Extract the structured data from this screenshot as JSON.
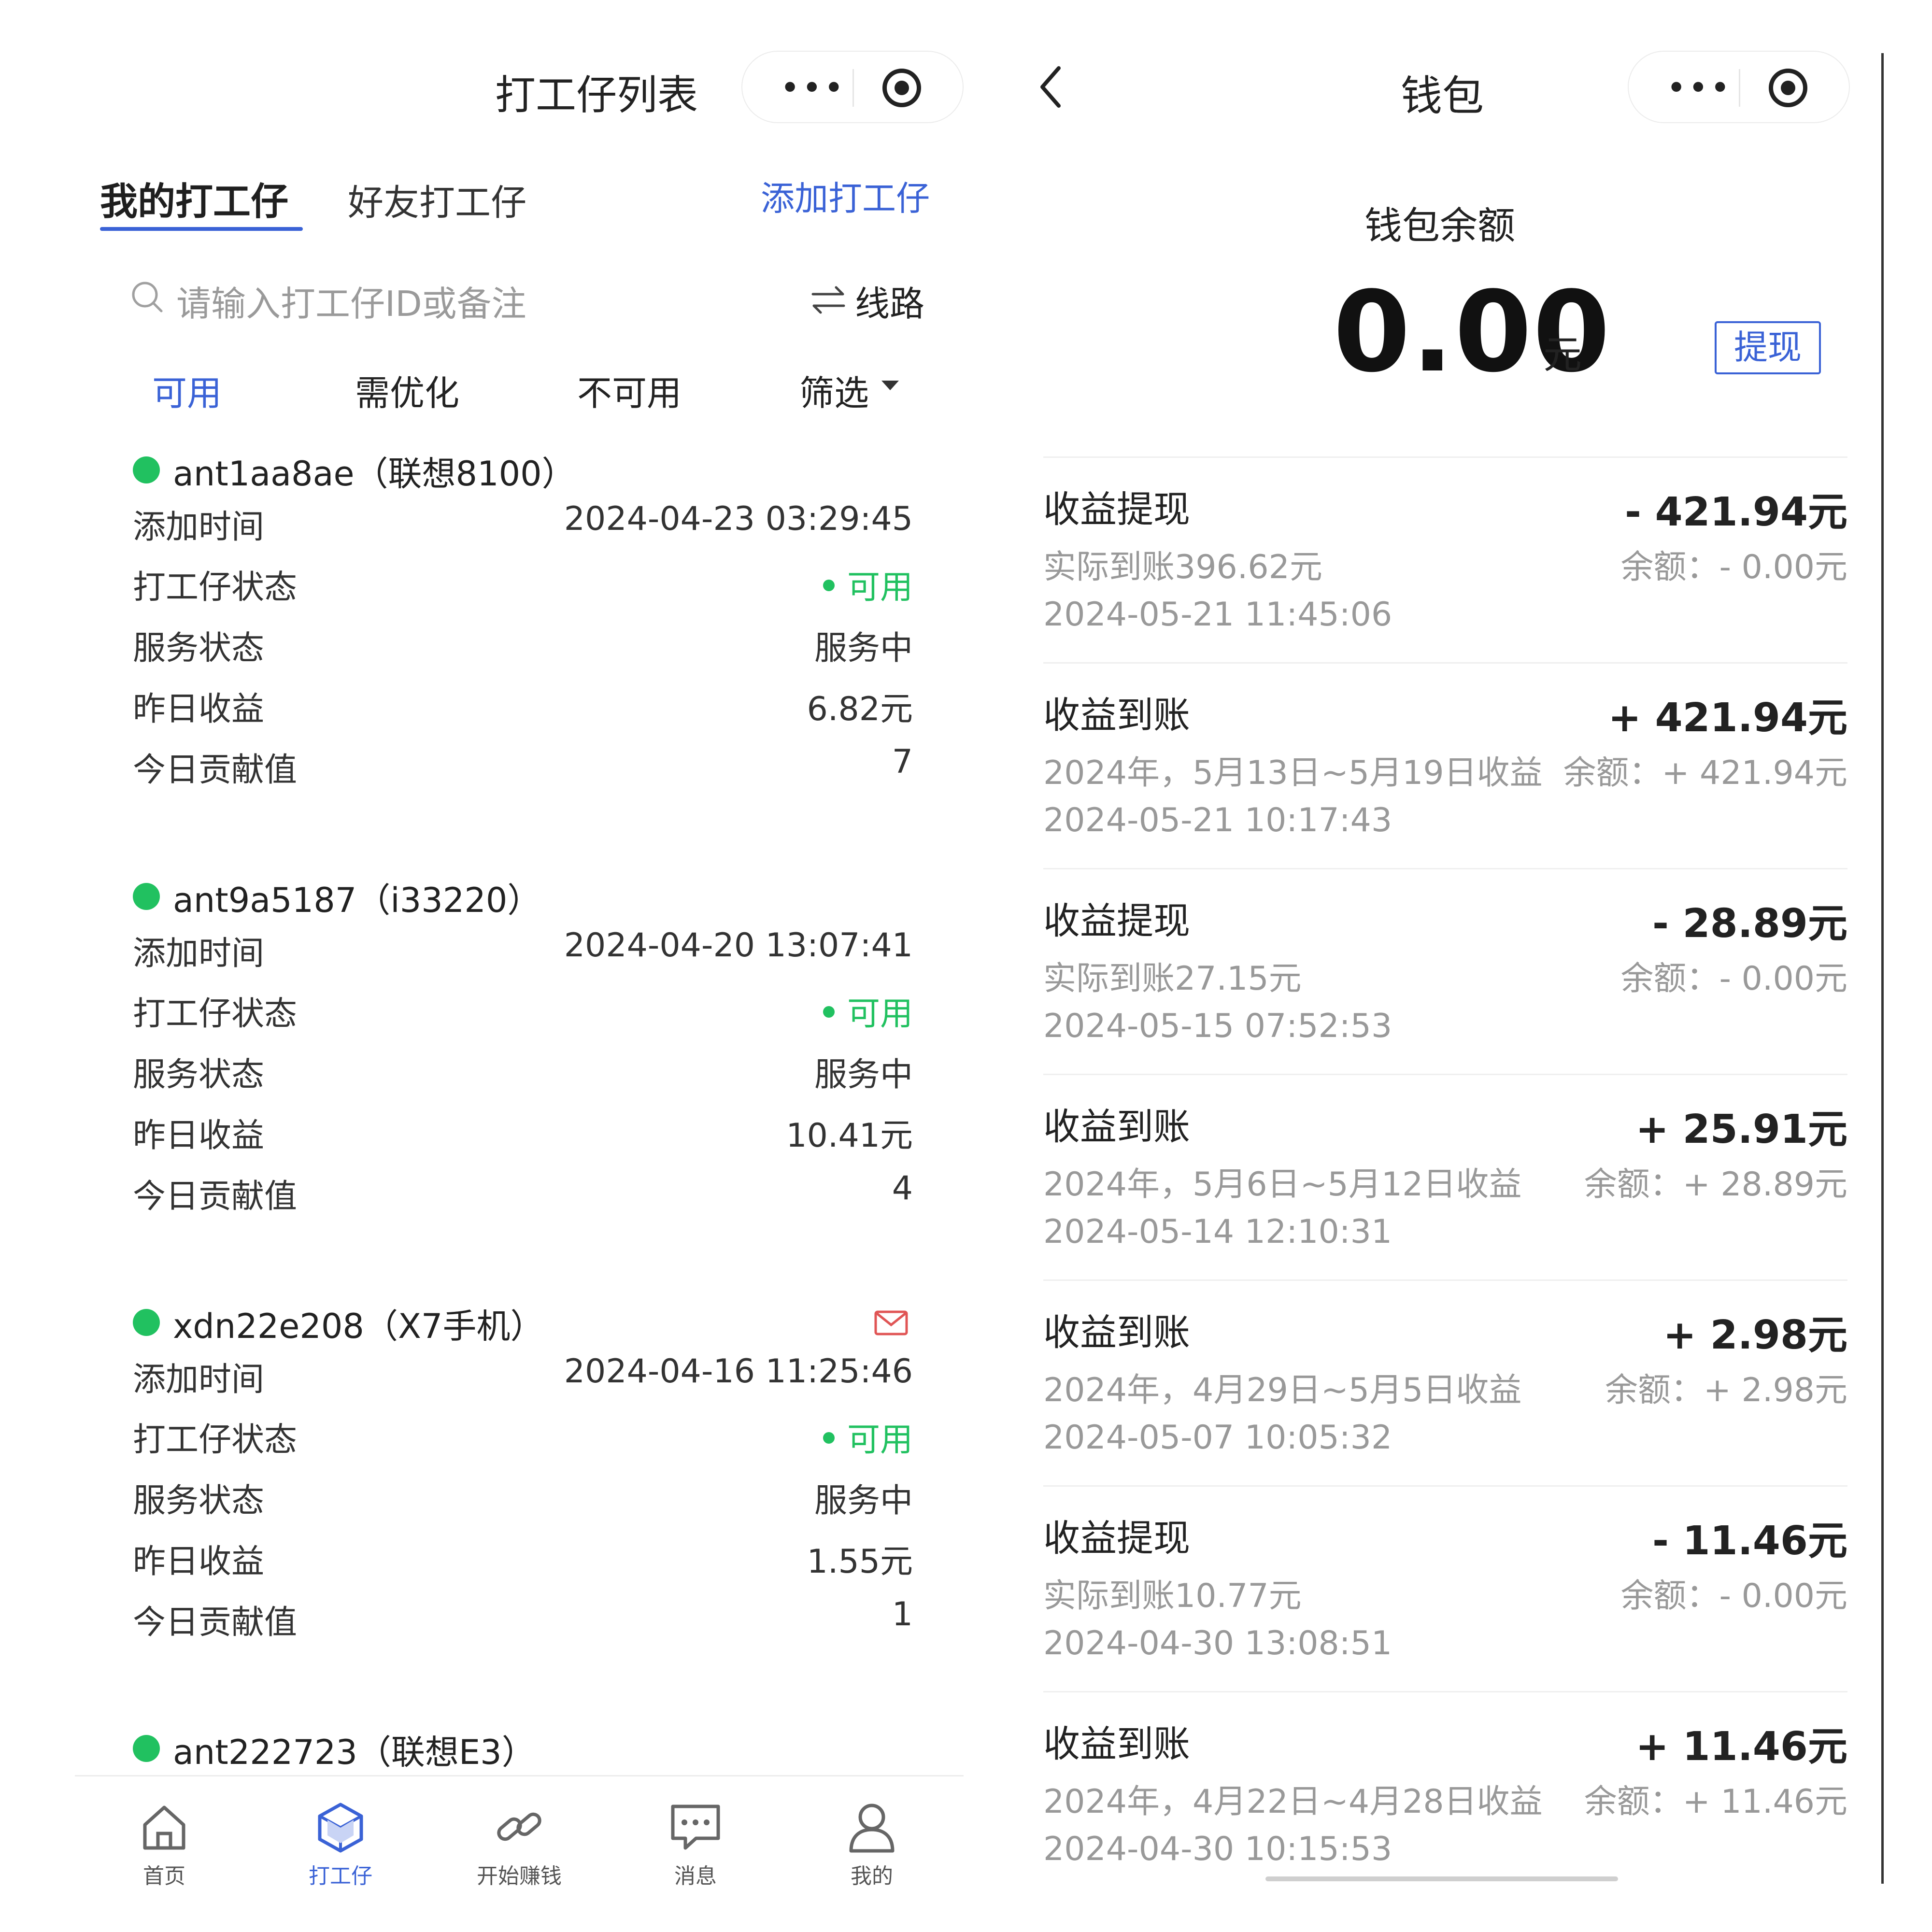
{
  "left": {
    "title": "打工仔列表",
    "capsule": {
      "more_icon": "more-dots-icon",
      "close_icon": "target-icon"
    },
    "tabs": {
      "mine": "我的打工仔",
      "friends": "好友打工仔",
      "add": "添加打工仔"
    },
    "search": {
      "placeholder": "请输入打工仔ID或备注",
      "route_label": "线路"
    },
    "filters": [
      "可用",
      "需优化",
      "不可用",
      "筛选"
    ],
    "workers": [
      {
        "name": "ant1aa8ae（联想8100）",
        "add_time_label": "添加时间",
        "add_time": "2024-04-23 03:29:45",
        "status_label": "打工仔状态",
        "status": "可用",
        "service_label": "服务状态",
        "service": "服务中",
        "yesterday_label": "昨日收益",
        "yesterday": "6.82元",
        "contrib_label": "今日贡献值",
        "contrib": "7"
      },
      {
        "name": "ant9a5187（i33220）",
        "add_time_label": "添加时间",
        "add_time": "2024-04-20 13:07:41",
        "status_label": "打工仔状态",
        "status": "可用",
        "service_label": "服务状态",
        "service": "服务中",
        "yesterday_label": "昨日收益",
        "yesterday": "10.41元",
        "contrib_label": "今日贡献值",
        "contrib": "4"
      },
      {
        "name": "xdn22e208（X7手机）",
        "add_time_label": "添加时间",
        "add_time": "2024-04-16 11:25:46",
        "status_label": "打工仔状态",
        "status": "可用",
        "service_label": "服务状态",
        "service": "服务中",
        "yesterday_label": "昨日收益",
        "yesterday": "1.55元",
        "contrib_label": "今日贡献值",
        "contrib": "1"
      },
      {
        "name": "ant222723（联想E3）"
      }
    ],
    "tabbar": [
      "首页",
      "打工仔",
      "开始赚钱",
      "消息",
      "我的"
    ]
  },
  "right": {
    "title": "钱包",
    "balance_label": "钱包余额",
    "balance": "0.00",
    "balance_unit": "元",
    "withdraw": "提现",
    "transactions": [
      {
        "title": "收益提现",
        "amount": "- 421.94元",
        "sub": "实际到账396.62元",
        "balance": "余额：- 0.00元",
        "time": "2024-05-21 11:45:06"
      },
      {
        "title": "收益到账",
        "amount": "+ 421.94元",
        "sub": "2024年，5月13日~5月19日收益",
        "balance": "余额：+ 421.94元",
        "time": "2024-05-21 10:17:43"
      },
      {
        "title": "收益提现",
        "amount": "- 28.89元",
        "sub": "实际到账27.15元",
        "balance": "余额：- 0.00元",
        "time": "2024-05-15 07:52:53"
      },
      {
        "title": "收益到账",
        "amount": "+ 25.91元",
        "sub": "2024年，5月6日~5月12日收益",
        "balance": "余额：+ 28.89元",
        "time": "2024-05-14 12:10:31"
      },
      {
        "title": "收益到账",
        "amount": "+ 2.98元",
        "sub": "2024年，4月29日~5月5日收益",
        "balance": "余额：+ 2.98元",
        "time": "2024-05-07 10:05:32"
      },
      {
        "title": "收益提现",
        "amount": "- 11.46元",
        "sub": "实际到账10.77元",
        "balance": "余额：- 0.00元",
        "time": "2024-04-30 13:08:51"
      },
      {
        "title": "收益到账",
        "amount": "+ 11.46元",
        "sub": "2024年，4月22日~4月28日收益",
        "balance": "余额：+ 11.46元",
        "time": "2024-04-30 10:15:53"
      }
    ]
  },
  "colors": {
    "accent": "#3a62d6",
    "ok": "#21c160",
    "mail": "#e05555"
  }
}
